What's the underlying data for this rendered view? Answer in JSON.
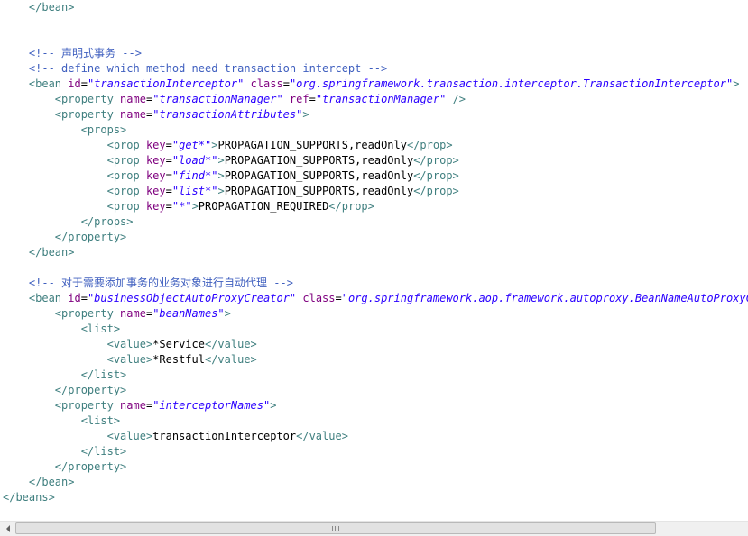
{
  "colors": {
    "background": "#ffffff",
    "text": "#000000",
    "tag": "#3f7f7f",
    "attribute": "#7f007f",
    "value": "#2a00ff",
    "comment": "#3f5fbf",
    "scrollbar_track": "#f0f0f0",
    "scrollbar_thumb": "#e2e2e2"
  },
  "code_lines": [
    {
      "indent": "    ",
      "tokens": [
        {
          "t": "tag",
          "v": "</bean>"
        }
      ]
    },
    {
      "indent": "",
      "tokens": []
    },
    {
      "indent": "",
      "tokens": []
    },
    {
      "indent": "    ",
      "tokens": [
        {
          "t": "com",
          "v": "<!-- 声明式事务 -->"
        }
      ]
    },
    {
      "indent": "    ",
      "tokens": [
        {
          "t": "com",
          "v": "<!-- define which method need transaction intercept -->"
        }
      ]
    },
    {
      "indent": "    ",
      "tokens": [
        {
          "t": "tag",
          "v": "<bean "
        },
        {
          "t": "attr",
          "v": "id"
        },
        {
          "t": "txt",
          "v": "="
        },
        {
          "t": "val",
          "v": "\"transactionInterceptor\""
        },
        {
          "t": "txt",
          "v": " "
        },
        {
          "t": "attr",
          "v": "class"
        },
        {
          "t": "txt",
          "v": "="
        },
        {
          "t": "val",
          "v": "\"org.springframework.transaction.interceptor.TransactionInterceptor\""
        },
        {
          "t": "tag",
          "v": ">"
        }
      ]
    },
    {
      "indent": "        ",
      "tokens": [
        {
          "t": "tag",
          "v": "<property "
        },
        {
          "t": "attr",
          "v": "name"
        },
        {
          "t": "txt",
          "v": "="
        },
        {
          "t": "val",
          "v": "\"transactionManager\""
        },
        {
          "t": "txt",
          "v": " "
        },
        {
          "t": "attr",
          "v": "ref"
        },
        {
          "t": "txt",
          "v": "="
        },
        {
          "t": "val",
          "v": "\"transactionManager\""
        },
        {
          "t": "txt",
          "v": " "
        },
        {
          "t": "tag",
          "v": "/>"
        }
      ]
    },
    {
      "indent": "        ",
      "tokens": [
        {
          "t": "tag",
          "v": "<property "
        },
        {
          "t": "attr",
          "v": "name"
        },
        {
          "t": "txt",
          "v": "="
        },
        {
          "t": "val",
          "v": "\"transactionAttributes\""
        },
        {
          "t": "tag",
          "v": ">"
        }
      ]
    },
    {
      "indent": "            ",
      "tokens": [
        {
          "t": "tag",
          "v": "<props>"
        }
      ]
    },
    {
      "indent": "                ",
      "tokens": [
        {
          "t": "tag",
          "v": "<prop "
        },
        {
          "t": "attr",
          "v": "key"
        },
        {
          "t": "txt",
          "v": "="
        },
        {
          "t": "val",
          "v": "\"get*\""
        },
        {
          "t": "tag",
          "v": ">"
        },
        {
          "t": "txt",
          "v": "PROPAGATION_SUPPORTS,readOnly"
        },
        {
          "t": "tag",
          "v": "</prop>"
        }
      ]
    },
    {
      "indent": "                ",
      "tokens": [
        {
          "t": "tag",
          "v": "<prop "
        },
        {
          "t": "attr",
          "v": "key"
        },
        {
          "t": "txt",
          "v": "="
        },
        {
          "t": "val",
          "v": "\"load*\""
        },
        {
          "t": "tag",
          "v": ">"
        },
        {
          "t": "txt",
          "v": "PROPAGATION_SUPPORTS,readOnly"
        },
        {
          "t": "tag",
          "v": "</prop>"
        }
      ]
    },
    {
      "indent": "                ",
      "tokens": [
        {
          "t": "tag",
          "v": "<prop "
        },
        {
          "t": "attr",
          "v": "key"
        },
        {
          "t": "txt",
          "v": "="
        },
        {
          "t": "val",
          "v": "\"find*\""
        },
        {
          "t": "tag",
          "v": ">"
        },
        {
          "t": "txt",
          "v": "PROPAGATION_SUPPORTS,readOnly"
        },
        {
          "t": "tag",
          "v": "</prop>"
        }
      ]
    },
    {
      "indent": "                ",
      "tokens": [
        {
          "t": "tag",
          "v": "<prop "
        },
        {
          "t": "attr",
          "v": "key"
        },
        {
          "t": "txt",
          "v": "="
        },
        {
          "t": "val",
          "v": "\"list*\""
        },
        {
          "t": "tag",
          "v": ">"
        },
        {
          "t": "txt",
          "v": "PROPAGATION_SUPPORTS,readOnly"
        },
        {
          "t": "tag",
          "v": "</prop>"
        }
      ]
    },
    {
      "indent": "                ",
      "tokens": [
        {
          "t": "tag",
          "v": "<prop "
        },
        {
          "t": "attr",
          "v": "key"
        },
        {
          "t": "txt",
          "v": "="
        },
        {
          "t": "val",
          "v": "\"*\""
        },
        {
          "t": "tag",
          "v": ">"
        },
        {
          "t": "txt",
          "v": "PROPAGATION_REQUIRED"
        },
        {
          "t": "tag",
          "v": "</prop>"
        }
      ]
    },
    {
      "indent": "            ",
      "tokens": [
        {
          "t": "tag",
          "v": "</props>"
        }
      ]
    },
    {
      "indent": "        ",
      "tokens": [
        {
          "t": "tag",
          "v": "</property>"
        }
      ]
    },
    {
      "indent": "    ",
      "tokens": [
        {
          "t": "tag",
          "v": "</bean>"
        }
      ]
    },
    {
      "indent": "",
      "tokens": []
    },
    {
      "indent": "    ",
      "tokens": [
        {
          "t": "com",
          "v": "<!-- 对于需要添加事务的业务对象进行自动代理 -->"
        }
      ]
    },
    {
      "indent": "    ",
      "tokens": [
        {
          "t": "tag",
          "v": "<bean "
        },
        {
          "t": "attr",
          "v": "id"
        },
        {
          "t": "txt",
          "v": "="
        },
        {
          "t": "val",
          "v": "\"businessObjectAutoProxyCreator\""
        },
        {
          "t": "txt",
          "v": " "
        },
        {
          "t": "attr",
          "v": "class"
        },
        {
          "t": "txt",
          "v": "="
        },
        {
          "t": "val",
          "v": "\"org.springframework.aop.framework.autoproxy.BeanNameAutoProxyCreator\""
        },
        {
          "t": "tag",
          "v": ">"
        }
      ]
    },
    {
      "indent": "        ",
      "tokens": [
        {
          "t": "tag",
          "v": "<property "
        },
        {
          "t": "attr",
          "v": "name"
        },
        {
          "t": "txt",
          "v": "="
        },
        {
          "t": "val",
          "v": "\"beanNames\""
        },
        {
          "t": "tag",
          "v": ">"
        }
      ]
    },
    {
      "indent": "            ",
      "tokens": [
        {
          "t": "tag",
          "v": "<list>"
        }
      ]
    },
    {
      "indent": "                ",
      "tokens": [
        {
          "t": "tag",
          "v": "<value>"
        },
        {
          "t": "txt",
          "v": "*Service"
        },
        {
          "t": "tag",
          "v": "</value>"
        }
      ]
    },
    {
      "indent": "                ",
      "tokens": [
        {
          "t": "tag",
          "v": "<value>"
        },
        {
          "t": "txt",
          "v": "*Restful"
        },
        {
          "t": "tag",
          "v": "</value>"
        }
      ]
    },
    {
      "indent": "            ",
      "tokens": [
        {
          "t": "tag",
          "v": "</list>"
        }
      ]
    },
    {
      "indent": "        ",
      "tokens": [
        {
          "t": "tag",
          "v": "</property>"
        }
      ]
    },
    {
      "indent": "        ",
      "tokens": [
        {
          "t": "tag",
          "v": "<property "
        },
        {
          "t": "attr",
          "v": "name"
        },
        {
          "t": "txt",
          "v": "="
        },
        {
          "t": "val",
          "v": "\"interceptorNames\""
        },
        {
          "t": "tag",
          "v": ">"
        }
      ]
    },
    {
      "indent": "            ",
      "tokens": [
        {
          "t": "tag",
          "v": "<list>"
        }
      ]
    },
    {
      "indent": "                ",
      "tokens": [
        {
          "t": "tag",
          "v": "<value>"
        },
        {
          "t": "txt",
          "v": "transactionInterceptor"
        },
        {
          "t": "tag",
          "v": "</value>"
        }
      ]
    },
    {
      "indent": "            ",
      "tokens": [
        {
          "t": "tag",
          "v": "</list>"
        }
      ]
    },
    {
      "indent": "        ",
      "tokens": [
        {
          "t": "tag",
          "v": "</property>"
        }
      ]
    },
    {
      "indent": "    ",
      "tokens": [
        {
          "t": "tag",
          "v": "</bean>"
        }
      ]
    },
    {
      "indent": "",
      "tokens": [
        {
          "t": "tag",
          "v": "</beans>"
        }
      ]
    }
  ],
  "scrollbar": {
    "horizontal_position": 0,
    "grip_icon": "grip-icon",
    "left_arrow_icon": "arrow-left-icon"
  }
}
